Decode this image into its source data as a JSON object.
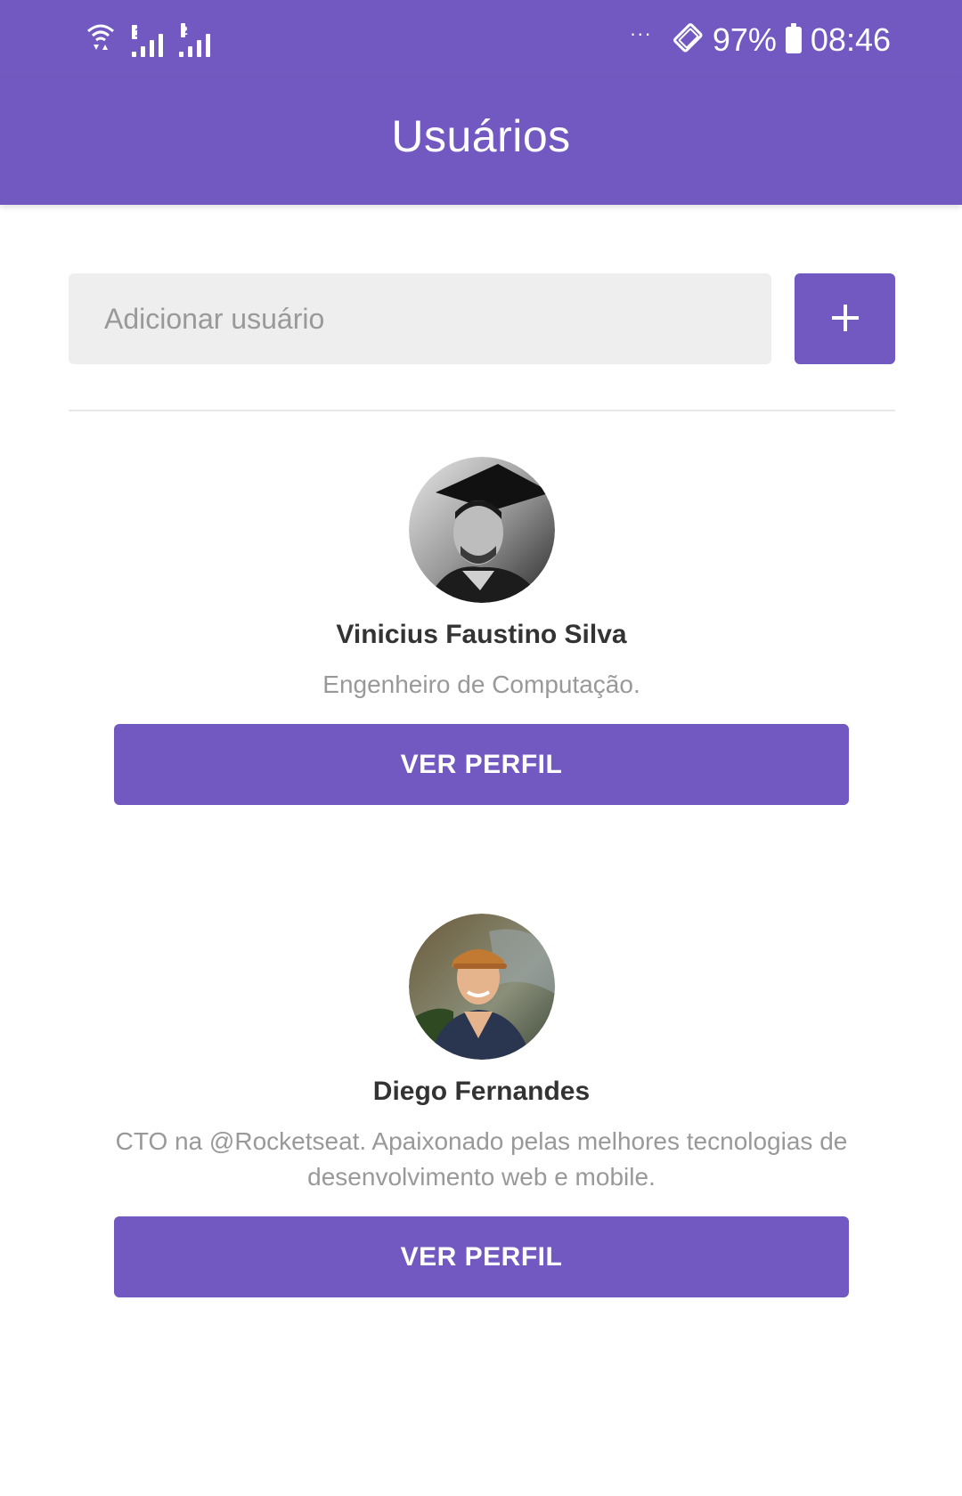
{
  "status_bar": {
    "sim1_label": "1",
    "sim2_label": "2",
    "dots": "···",
    "battery_percent": "97%",
    "time": "08:46",
    "icons": [
      "wifi-icon",
      "signal-sim1-icon",
      "signal-sim2-icon",
      "more-dots-icon",
      "auto-rotate-icon",
      "battery-icon"
    ]
  },
  "app_bar": {
    "title": "Usuários"
  },
  "form": {
    "input_placeholder": "Adicionar usuário",
    "input_value": "",
    "add_button_icon": "plus-icon"
  },
  "users": [
    {
      "name": "Vinicius Faustino Silva",
      "bio": "Engenheiro de Computação.",
      "button_label": "VER PERFIL"
    },
    {
      "name": "Diego Fernandes",
      "bio": "CTO na @Rocketseat. Apaixonado pelas melhores tecnologias de desenvolvimento web e mobile.",
      "button_label": "VER PERFIL"
    }
  ],
  "colors": {
    "primary": "#7159c1",
    "input_bg": "#eeeeee",
    "name_text": "#333333",
    "bio_text": "#999999"
  }
}
